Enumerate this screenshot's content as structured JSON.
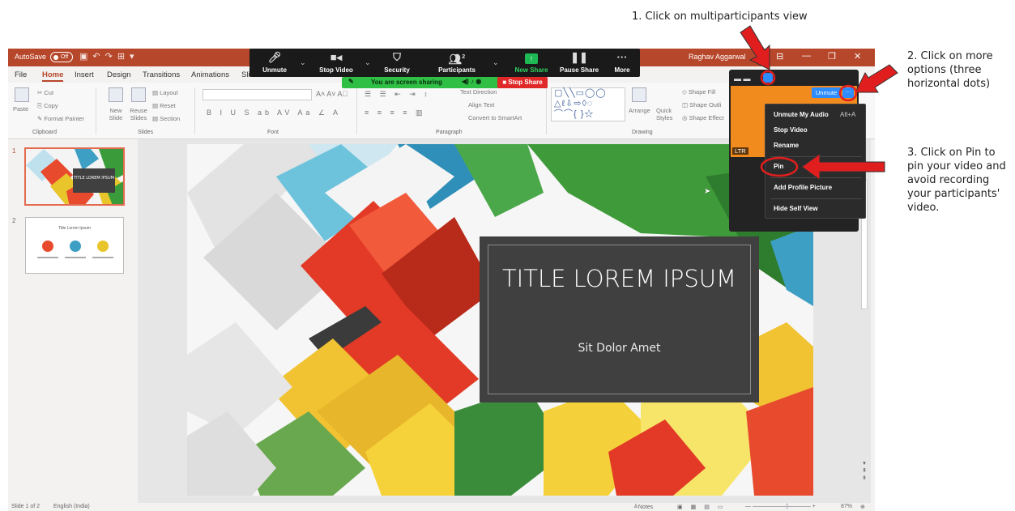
{
  "annotations": {
    "step1": "1. Click on multiparticipants view",
    "step2": "2. Click on more options (three horizontal dots)",
    "step3": "3. Click on Pin to pin your video and avoid recording your participants' video."
  },
  "powerpoint": {
    "autosave_label": "AutoSave",
    "autosave_state": "Off",
    "user_name": "Raghav Aggarwal",
    "tabs": [
      "File",
      "Home",
      "Insert",
      "Design",
      "Transitions",
      "Animations",
      "Sli"
    ],
    "active_tab": "Home",
    "ribbon": {
      "paste": "Paste",
      "cut": "Cut",
      "copy": "Copy",
      "format_painter": "Format Painter",
      "clipboard": "Clipboard",
      "new_slide": "New Slide",
      "reuse_slides": "Reuse Slides",
      "layout": "Layout",
      "reset": "Reset",
      "section": "Section",
      "slides": "Slides",
      "font": "Font",
      "paragraph": "Paragraph",
      "text_direction": "Text Direction",
      "align_text": "Align Text",
      "convert_smartart": "Convert to SmartArt",
      "arrange": "Arrange",
      "quick_styles": "Quick Styles",
      "shape_fill": "Shape Fill",
      "shape_outline": "Shape Outli",
      "shape_effects": "Shape Effect",
      "drawing": "Drawing"
    },
    "slide2_title": "Title Lorem Ipsum",
    "slide": {
      "title": "TITLE LOREM IPSUM",
      "subtitle": "Sit Dolor Amet"
    },
    "thumb1_title": "TITLE LOREM IPSUM",
    "status": {
      "slide_count": "Slide 1 of 2",
      "language": "English (India)",
      "notes": "Notes",
      "zoom": "87%"
    }
  },
  "zoom": {
    "toolbar": {
      "unmute": "Unmute",
      "stop_video": "Stop Video",
      "security": "Security",
      "participants": "Participants",
      "participants_count": "2",
      "new_share": "New Share",
      "pause_share": "Pause Share",
      "more": "More"
    },
    "sharing_text": "You are screen sharing",
    "stop_share": "Stop Share",
    "video_panel": {
      "unmute": "Unmute",
      "more_dots": "···",
      "name_tag": "LTR"
    },
    "menu": {
      "unmute_my_audio": "Unmute My Audio",
      "unmute_shortcut": "Alt+A",
      "stop_video": "Stop Video",
      "rename": "Rename",
      "pin": "Pin",
      "add_profile_picture": "Add Profile Picture",
      "hide_self_view": "Hide Self View"
    }
  },
  "colors": {
    "ppt_accent": "#b7472a",
    "zoom_blue": "#2d8cff",
    "zoom_green": "#2fbf45",
    "stop_red": "#e02828",
    "annotation_red": "#e01e1e",
    "video_orange": "#f28b1d"
  }
}
